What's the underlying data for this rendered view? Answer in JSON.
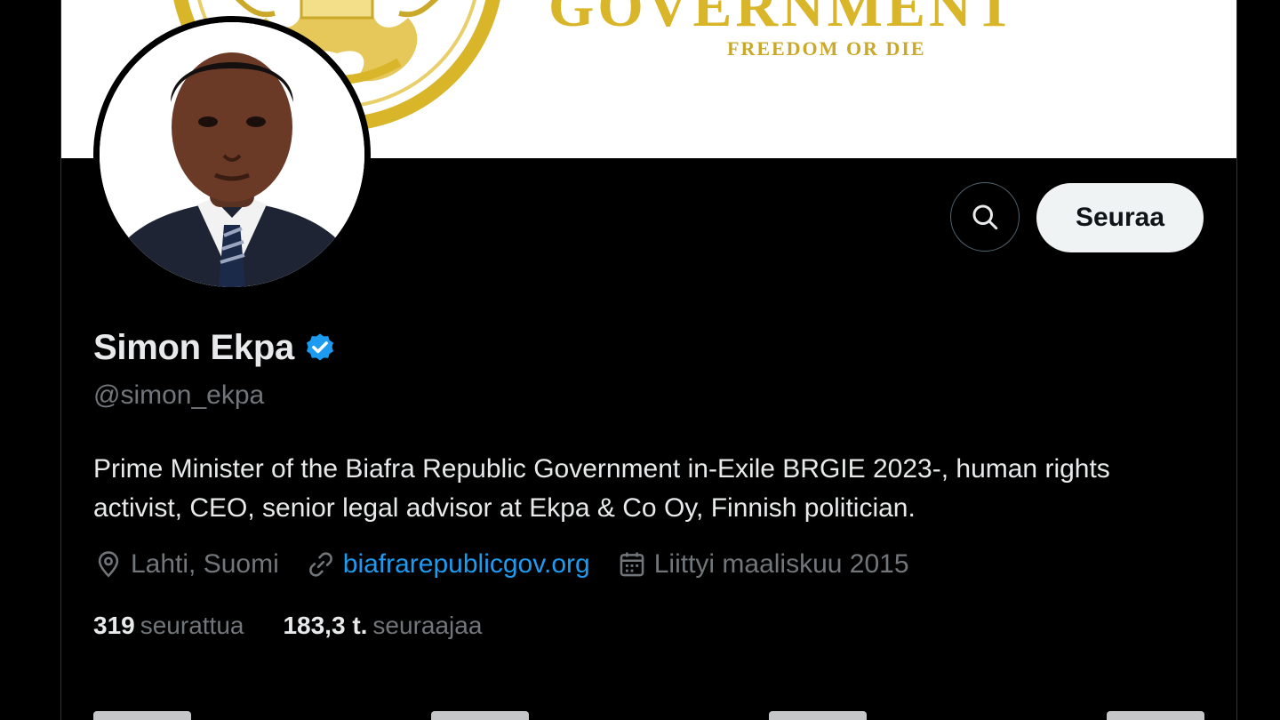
{
  "banner": {
    "heading": "GOVERNMENT",
    "motto": "FREEDOM OR DIE"
  },
  "profile": {
    "display_name": "Simon Ekpa",
    "handle": "@simon_ekpa",
    "verified": true,
    "bio": "Prime Minister of the Biafra Republic Government in-Exile BRGIE 2023-, human rights activist, CEO, senior legal advisor at Ekpa & Co Oy, Finnish politician.",
    "location": "Lahti, Suomi",
    "website": "biafrarepublicgov.org",
    "joined": "Liittyi maaliskuu 2015"
  },
  "actions": {
    "search_icon": "search-icon",
    "follow_label": "Seuraa"
  },
  "stats": {
    "following_count": "319",
    "following_label": "seurattua",
    "followers_count": "183,3 t.",
    "followers_label": "seuraajaa"
  },
  "colors": {
    "background": "#000000",
    "accent": "#1d9bf0",
    "banner_gold": "#d9b52a",
    "muted_text": "#71767b",
    "primary_text": "#e7e9ea"
  }
}
